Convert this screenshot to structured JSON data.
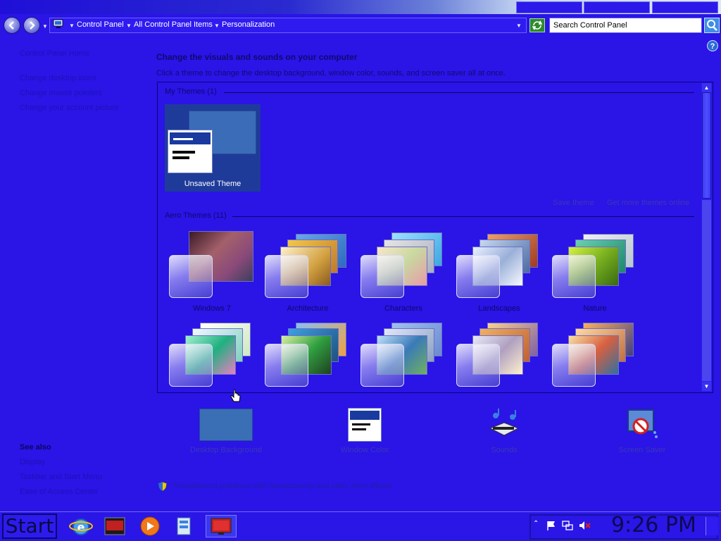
{
  "address": {
    "crumbs": [
      "Control Panel",
      "All Control Panel Items",
      "Personalization"
    ],
    "search_placeholder": "Search Control Panel"
  },
  "left_pane": {
    "links": [
      "Control Panel Home",
      "Change desktop icons",
      "Change mouse pointers",
      "Change your account picture"
    ],
    "see_also_title": "See also",
    "see_also": [
      "Display",
      "Taskbar and Start Menu",
      "Ease of Access Center"
    ]
  },
  "main": {
    "title": "Change the visuals and sounds on your computer",
    "subtitle": "Click a theme to change the desktop background, window color, sounds, and screen saver all at once."
  },
  "gallery": {
    "my_themes_label": "My Themes (1)",
    "unsaved_theme": "Unsaved Theme",
    "save_theme": "Save theme",
    "get_more": "Get more themes online",
    "aero_label": "Aero Themes (11)",
    "themes": [
      "Windows 7",
      "Architecture",
      "Characters",
      "Landscapes",
      "Nature"
    ]
  },
  "settings": {
    "desktop_background": "Desktop Background",
    "window_color": "Window Color",
    "sounds": "Sounds",
    "screen_saver": "Screen Saver"
  },
  "troubleshoot": "Troubleshoot problems with transparency and other Aero effects",
  "taskbar": {
    "start": "Start",
    "clock": "9:26 PM"
  },
  "colors": {
    "window_bg": "#2a14e6",
    "accent": "#1f3b9a"
  }
}
